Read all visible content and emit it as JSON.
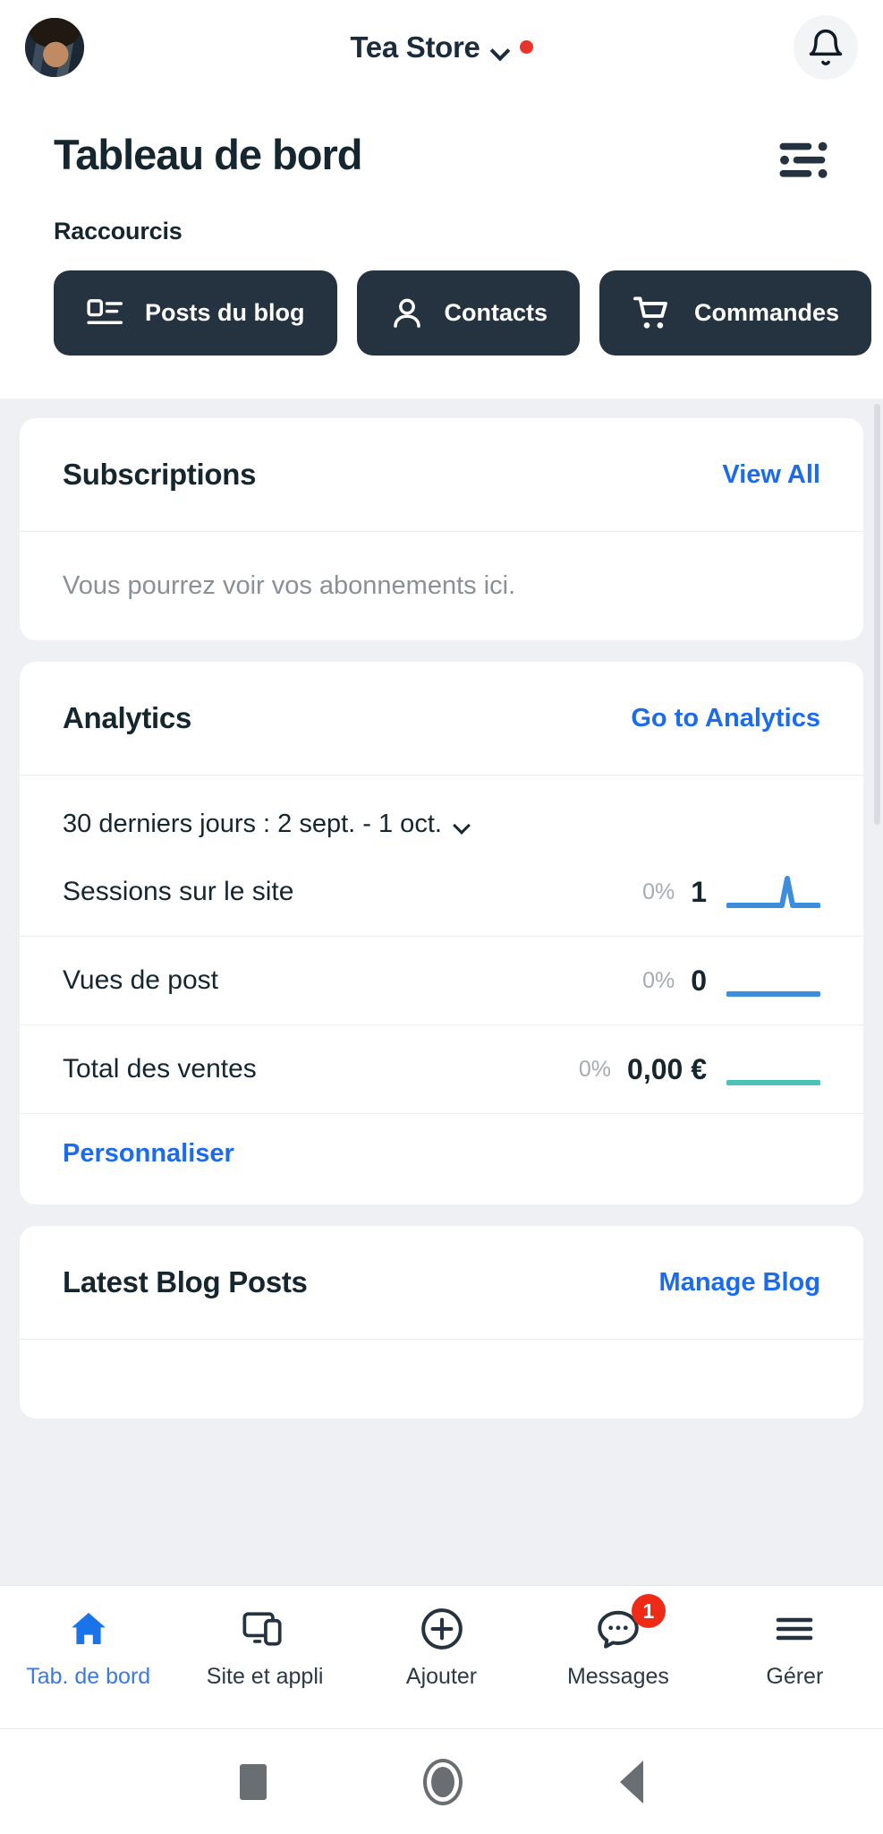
{
  "topbar": {
    "avatar_name": "user-avatar",
    "store_name": "Tea Store",
    "chevron_icon": "chevron-down-icon",
    "status_dot": "red-status-dot",
    "bell_icon": "bell-icon"
  },
  "header": {
    "title": "Tableau de bord",
    "list_icon": "list-reorder-icon",
    "shortcuts_label": "Raccourcis"
  },
  "shortcuts": [
    {
      "label": "Posts du blog",
      "icon": "blog-post-icon"
    },
    {
      "label": "Contacts",
      "icon": "person-icon"
    },
    {
      "label": "Commandes",
      "icon": "shopping-cart-icon"
    }
  ],
  "subscriptions": {
    "title": "Subscriptions",
    "link": "View All",
    "empty_text": "Vous pourrez voir vos abonnements ici."
  },
  "analytics": {
    "title": "Analytics",
    "link": "Go to Analytics",
    "date_range": "30 derniers jours : 2 sept. - 1 oct.",
    "date_chevron_icon": "chevron-down-icon",
    "customize_link": "Personnaliser",
    "metrics": [
      {
        "name": "Sessions sur le site",
        "pct": "0%",
        "value": "1",
        "color": "#3d8ddd",
        "spark": "spike"
      },
      {
        "name": "Vues de post",
        "pct": "0%",
        "value": "0",
        "color": "#3d8ddd",
        "spark": "flat"
      },
      {
        "name": "Total des ventes",
        "pct": "0%",
        "value": "0,00 €",
        "color": "#4bc2b5",
        "spark": "flat"
      }
    ]
  },
  "blog": {
    "title": "Latest Blog Posts",
    "link": "Manage Blog"
  },
  "bottom_nav": [
    {
      "label": "Tab. de bord",
      "icon": "home-icon",
      "active": true,
      "badge": ""
    },
    {
      "label": "Site et appli",
      "icon": "devices-icon",
      "active": false,
      "badge": ""
    },
    {
      "label": "Ajouter",
      "icon": "plus-circle-icon",
      "active": false,
      "badge": ""
    },
    {
      "label": "Messages",
      "icon": "chat-bubble-icon",
      "active": false,
      "badge": "1"
    },
    {
      "label": "Gérer",
      "icon": "hamburger-menu-icon",
      "active": false,
      "badge": ""
    }
  ],
  "system_nav": [
    {
      "icon": "recent-apps-square-icon"
    },
    {
      "icon": "home-circle-icon"
    },
    {
      "icon": "back-triangle-icon"
    }
  ],
  "colors": {
    "accent_blue": "#1b6bec",
    "chip_dark": "#24333f",
    "page_bg": "#eef0f4",
    "badge_red": "#ef2b17",
    "teal": "#4bc2b5"
  }
}
